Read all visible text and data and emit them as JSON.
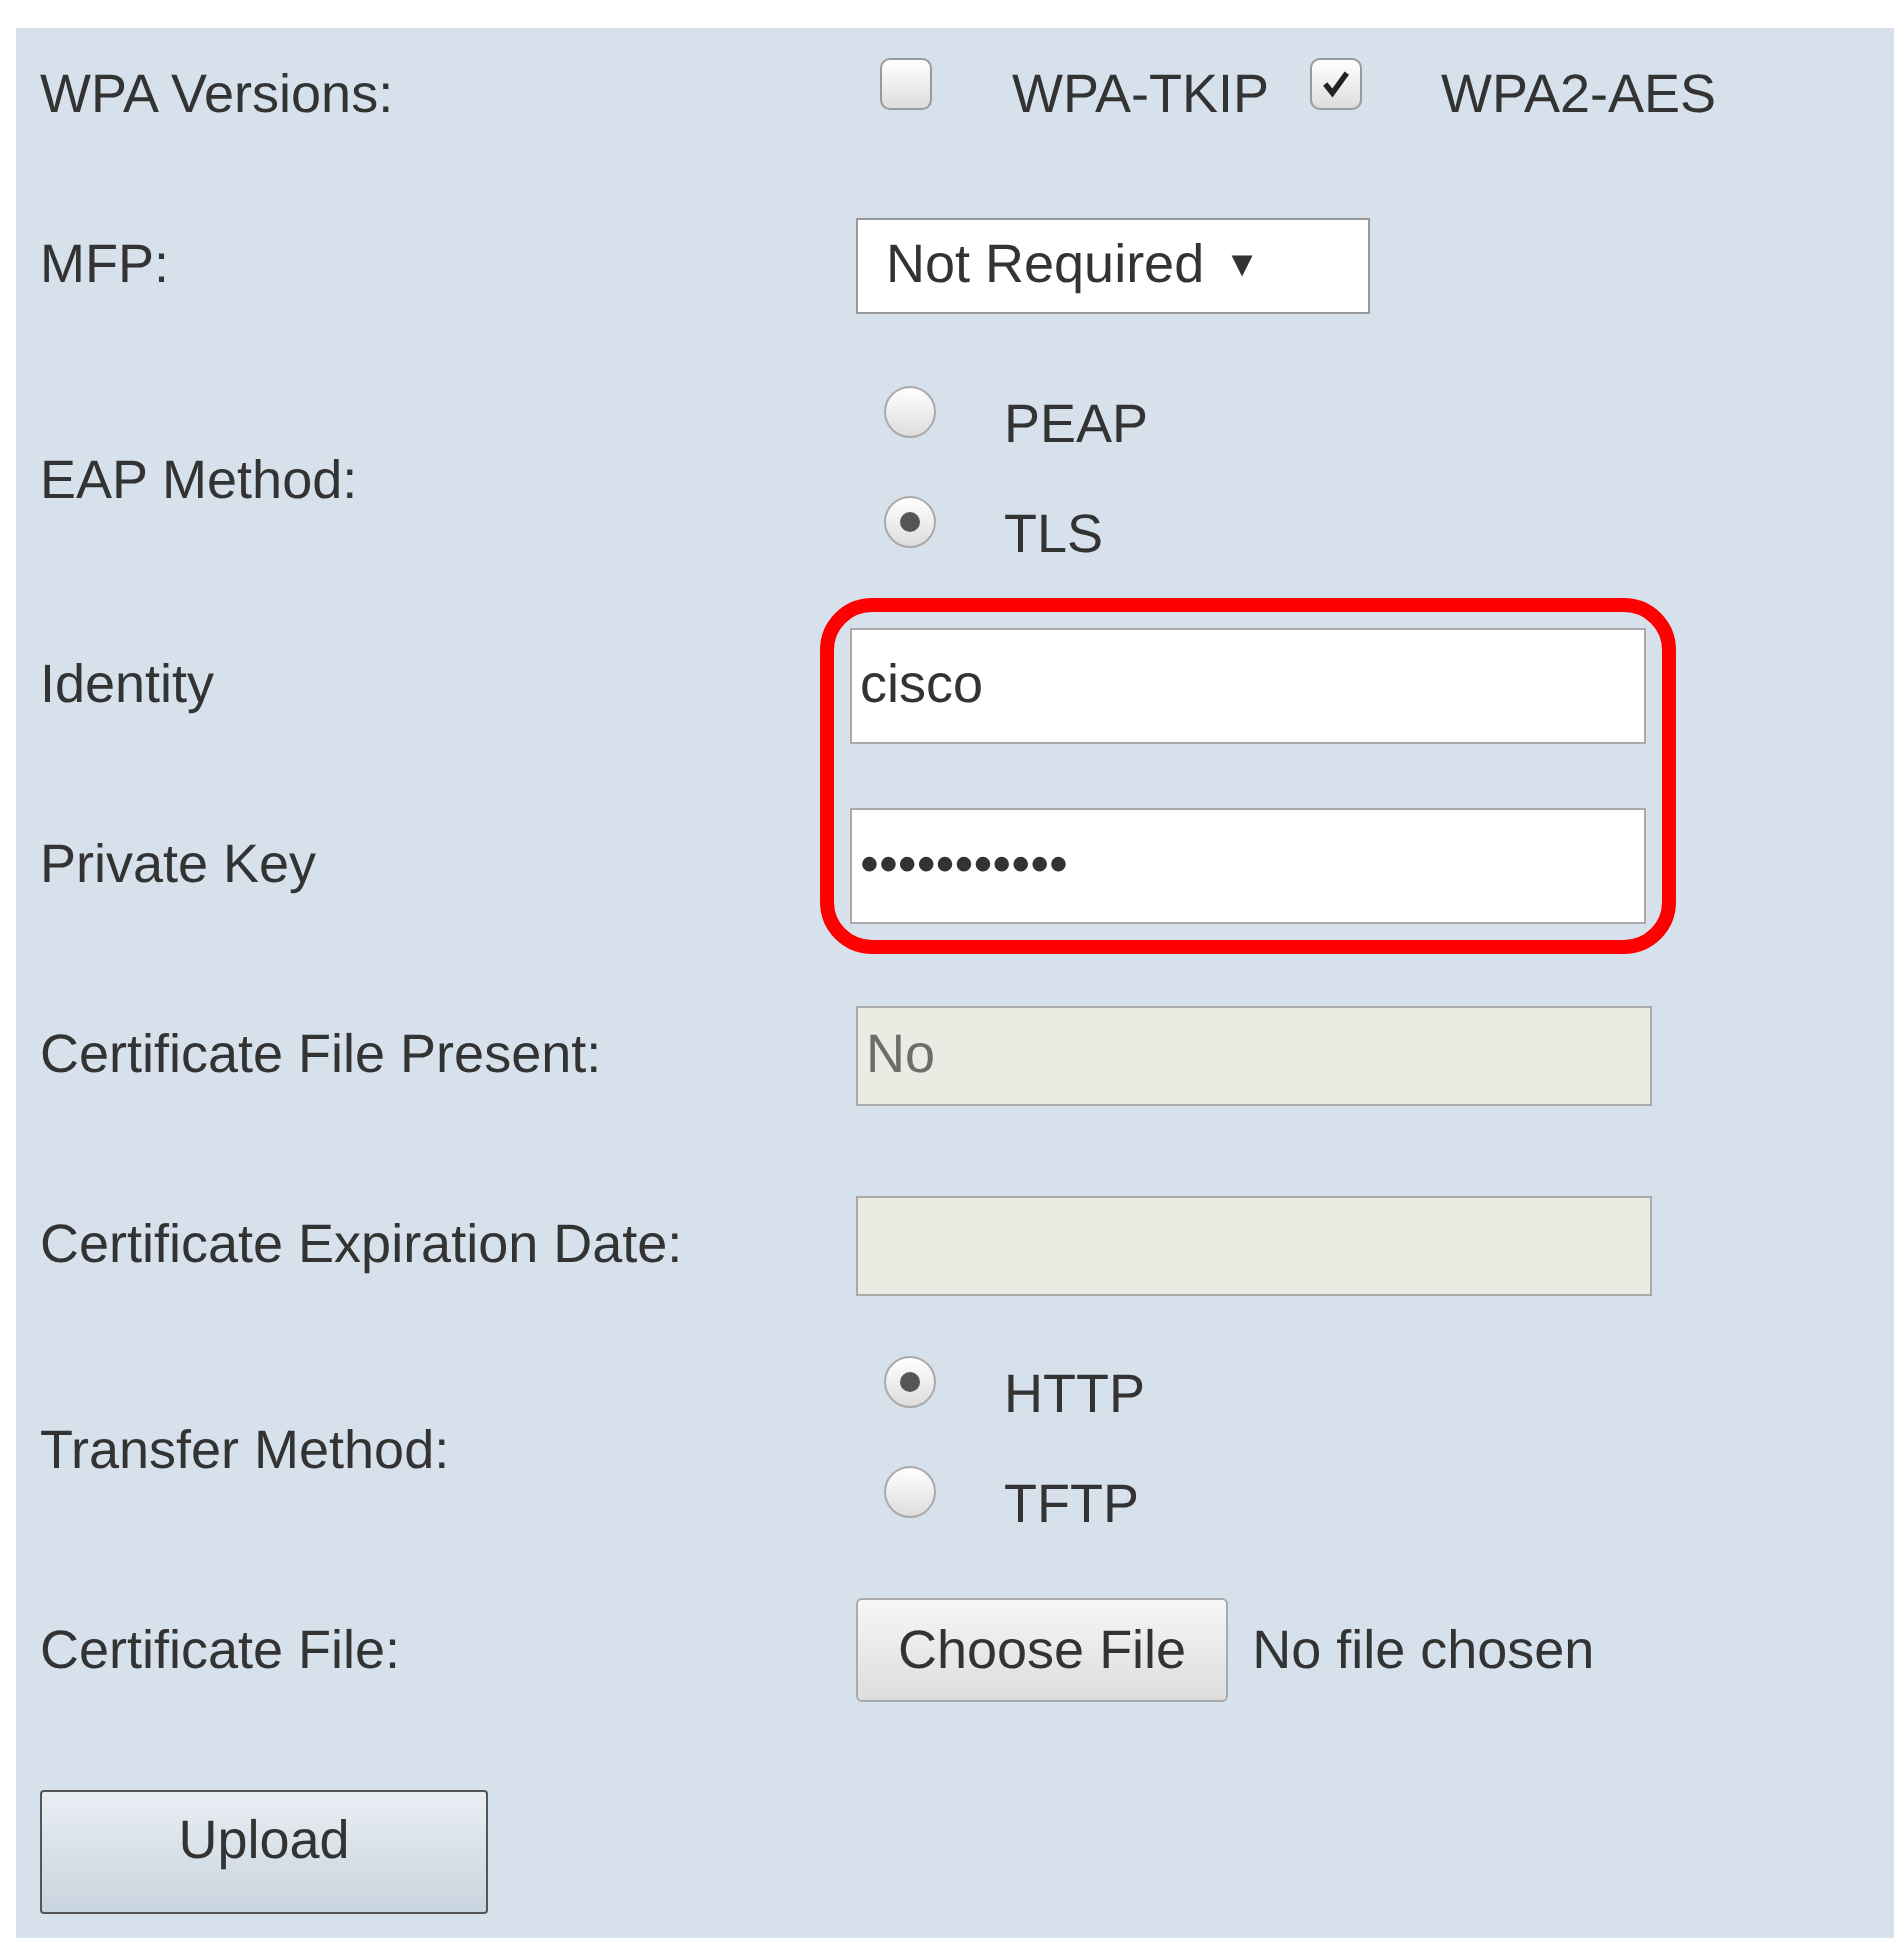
{
  "rows": [
    {
      "kind": "checkboxes",
      "label": "WPA Versions:",
      "options": [
        {
          "label": "WPA-TKIP",
          "checked": false
        },
        {
          "label": "WPA2-AES",
          "checked": true
        }
      ]
    },
    {
      "kind": "select",
      "label": "MFP:",
      "value": "Not Required",
      "arrow": "▼"
    },
    {
      "kind": "radios",
      "label": "EAP Method:",
      "options": [
        {
          "label": "PEAP",
          "selected": false
        },
        {
          "label": "TLS",
          "selected": true
        }
      ]
    },
    {
      "kind": "group",
      "highlighted": true,
      "rows": [
        {
          "label": "Identity",
          "value": "cisco",
          "disabled": false
        },
        {
          "label": "Private Key",
          "value": "•••••••••••",
          "disabled": false
        }
      ]
    },
    {
      "kind": "text",
      "label": "Certificate File Present:",
      "value": "No",
      "disabled": true
    },
    {
      "kind": "text",
      "label": "Certificate Expiration Date:",
      "disabled": true
    },
    {
      "kind": "radios",
      "label": "Transfer Method:",
      "options": [
        {
          "label": "HTTP",
          "selected": true
        },
        {
          "label": "TFTP",
          "selected": false
        }
      ]
    },
    {
      "kind": "file",
      "label": "Certificate File:",
      "button": "Choose File",
      "status": "No file chosen"
    }
  ],
  "upload_button": "Upload"
}
